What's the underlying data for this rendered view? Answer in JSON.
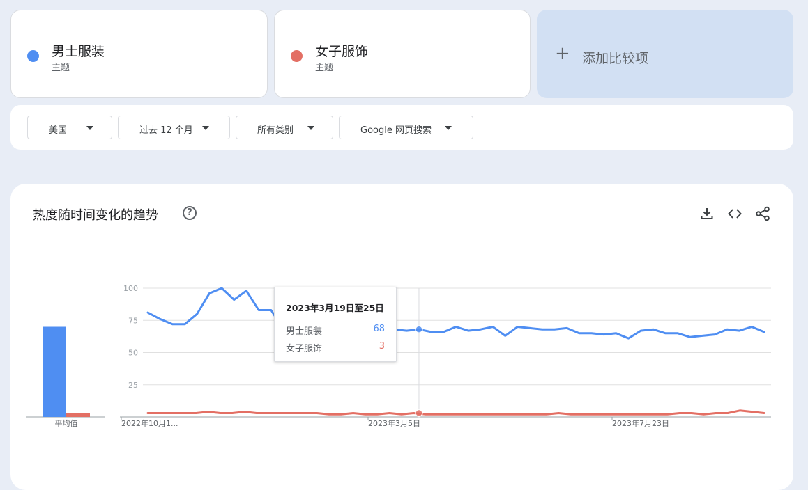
{
  "terms": [
    {
      "name": "男士服装",
      "type": "主题",
      "color": "#4f8ef2"
    },
    {
      "name": "女子服饰",
      "type": "主题",
      "color": "#e36f64"
    }
  ],
  "add_compare": {
    "label": "添加比较项"
  },
  "filters": [
    {
      "label": "美国"
    },
    {
      "label": "过去 12 个月"
    },
    {
      "label": "所有类别"
    },
    {
      "label": "Google 网页搜索"
    }
  ],
  "panel": {
    "title": "热度随时间变化的趋势",
    "help_icon": "question-circle-icon",
    "tools": [
      "download-icon",
      "embed-code-icon",
      "share-icon"
    ]
  },
  "tooltip": {
    "date": "2023年3月19日至25日",
    "rows": [
      {
        "label": "男士服装",
        "value": "68",
        "color": "#4f8ef2"
      },
      {
        "label": "女子服饰",
        "value": "3",
        "color": "#e36f64"
      }
    ]
  },
  "chart_data": [
    {
      "type": "bar",
      "categories": [
        "平均值"
      ],
      "series": [
        {
          "name": "男士服装",
          "values": [
            70
          ]
        },
        {
          "name": "女子服饰",
          "values": [
            3
          ]
        }
      ],
      "ylim": [
        0,
        100
      ]
    },
    {
      "type": "line",
      "x_tick_labels": [
        "2022年10月1...",
        "2023年3月5日",
        "2023年7月23日"
      ],
      "y_ticks": [
        25,
        50,
        75,
        100
      ],
      "ylim": [
        0,
        100
      ],
      "grid": true,
      "highlight_index": 22,
      "series": [
        {
          "name": "男士服装",
          "color": "#4f8ef2",
          "values": [
            81,
            76,
            72,
            72,
            80,
            96,
            100,
            91,
            98,
            83,
            83,
            68,
            68,
            68,
            68,
            68,
            68,
            68,
            63,
            69,
            68,
            67,
            68,
            66,
            66,
            70,
            67,
            68,
            70,
            63,
            70,
            69,
            68,
            68,
            69,
            65,
            65,
            64,
            65,
            61,
            67,
            68,
            65,
            65,
            62,
            63,
            64,
            68,
            67,
            70,
            66
          ]
        },
        {
          "name": "女子服饰",
          "color": "#e36f64",
          "values": [
            3,
            3,
            3,
            3,
            3,
            4,
            3,
            3,
            4,
            3,
            3,
            3,
            3,
            3,
            3,
            2,
            2,
            3,
            2,
            2,
            3,
            2,
            3,
            2,
            2,
            2,
            2,
            2,
            2,
            2,
            2,
            2,
            2,
            2,
            3,
            2,
            2,
            2,
            2,
            2,
            2,
            2,
            2,
            2,
            3,
            3,
            2,
            3,
            3,
            5,
            4,
            3
          ]
        }
      ]
    }
  ]
}
